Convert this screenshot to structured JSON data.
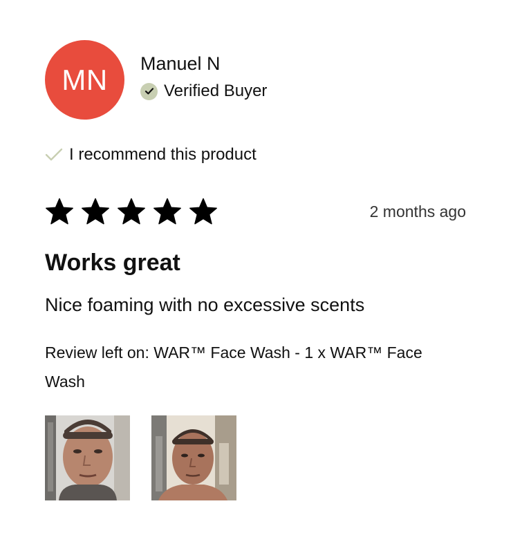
{
  "reviewer": {
    "initials": "MN",
    "name": "Manuel N",
    "badge": "Verified Buyer",
    "avatar_color": "#e84c3d",
    "badge_icon": "check-circle-icon",
    "badge_icon_color": "#c8cfb2"
  },
  "recommendation": {
    "label": "I recommend this product",
    "icon": "check-icon",
    "icon_color": "#c8cfb2"
  },
  "rating": {
    "stars": 5,
    "max": 5,
    "date": "2 months ago"
  },
  "review": {
    "title": "Works great",
    "body": "Nice foaming with no excessive scents",
    "product": "Review left on: WAR™ Face Wash - 1 x WAR™ Face Wash"
  },
  "photos": [
    {
      "name": "review-photo-1"
    },
    {
      "name": "review-photo-2"
    }
  ]
}
